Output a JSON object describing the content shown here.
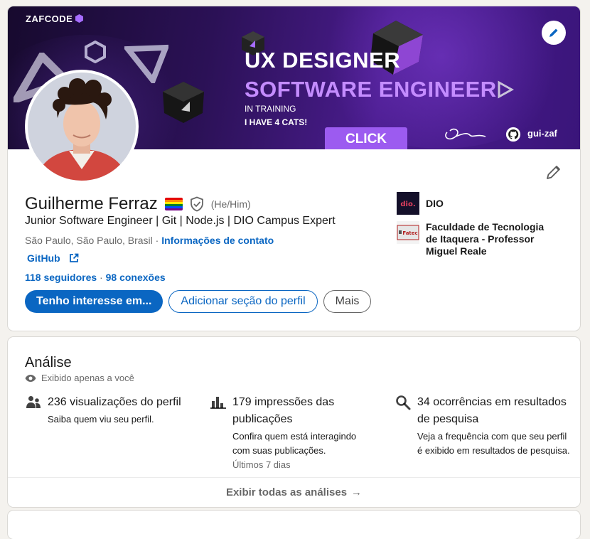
{
  "banner": {
    "logo_text": "ZAFCODE",
    "line1": "UX DESIGNER",
    "line2": "SOFTWARE ENGINEER",
    "line3": "IN TRAINING",
    "line4": "I HAVE 4 CATS!",
    "cta": "CLICK HERE",
    "github_handle": "gui-zaf",
    "colors": {
      "bg_dark": "#170a2e",
      "bg_purple": "#4a1c8e",
      "accent": "#c48cff",
      "cta": "#9c5bf0"
    }
  },
  "profile": {
    "name": "Guilherme Ferraz",
    "pronouns": "(He/Him)",
    "headline": "Junior Software Engineer | Git | Node.js | DIO Campus Expert",
    "location": "São Paulo, São Paulo, Brasil",
    "location_sep": " · ",
    "contact_info": "Informações de contato",
    "website": "GitHub",
    "followers": "118 seguidores",
    "stats_sep": " · ",
    "connections": "98 conexões",
    "badges": [
      "pride-flag-icon",
      "verified-shield-icon"
    ]
  },
  "actions": {
    "open_to": "Tenho interesse em...",
    "add_section": "Adicionar seção do perfil",
    "more": "Mais"
  },
  "experience": [
    {
      "label": "DIO",
      "logo_text": "dio."
    },
    {
      "label": "Faculdade de Tecnologia de Itaquera - Professor Miguel Reale",
      "logo_text": "Fatec"
    }
  ],
  "analytics": {
    "title": "Análise",
    "private_note": "Exibido apenas a você",
    "metrics": [
      {
        "title": "236 visualizações do perfil",
        "desc": "Saiba quem viu seu perfil.",
        "note": ""
      },
      {
        "title": "179 impressões das publicações",
        "desc": "Confira quem está interagindo com suas publicações.",
        "note": "Últimos 7 dias"
      },
      {
        "title": "34 ocorrências em resultados de pesquisa",
        "desc": "Veja a frequência com que seu perfil é exibido em resultados de pesquisa.",
        "note": ""
      }
    ],
    "footer": "Exibir todas as análises",
    "footer_arrow": "→"
  },
  "colors": {
    "link": "#0a66c2",
    "page_bg": "#f4f2ee"
  }
}
